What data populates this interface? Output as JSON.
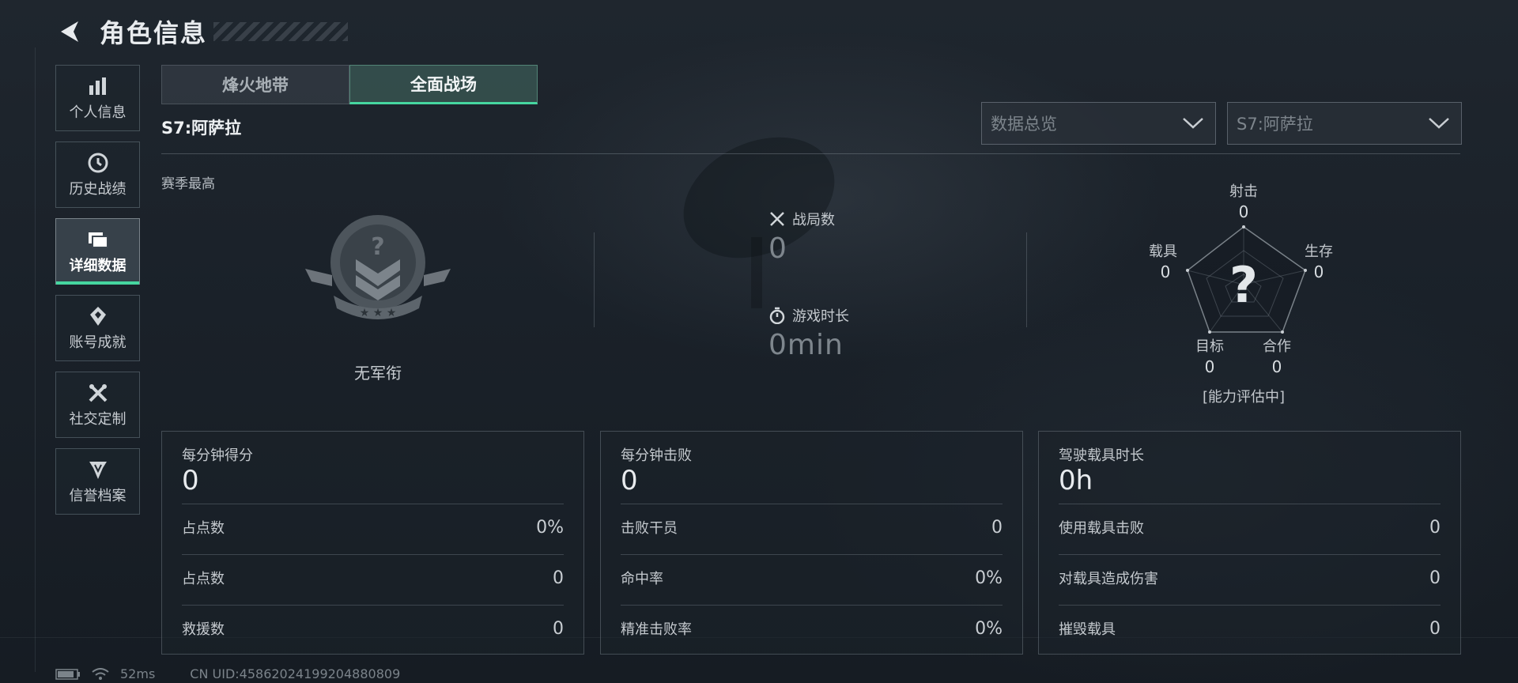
{
  "header": {
    "title": "角色信息"
  },
  "sidebar": {
    "items": [
      {
        "label": "个人信息",
        "icon": "bar-chart-icon"
      },
      {
        "label": "历史战绩",
        "icon": "history-icon"
      },
      {
        "label": "详细数据",
        "icon": "folder-icon",
        "active": true
      },
      {
        "label": "账号成就",
        "icon": "achievement-icon"
      },
      {
        "label": "社交定制",
        "icon": "tools-icon"
      },
      {
        "label": "信誉档案",
        "icon": "credit-badge-icon"
      }
    ]
  },
  "tabs": [
    {
      "label": "烽火地带",
      "active": false
    },
    {
      "label": "全面战场",
      "active": true
    }
  ],
  "season_title": "S7:阿萨拉",
  "dropdowns": {
    "data_type": "数据总览",
    "season": "S7:阿萨拉"
  },
  "season_best": {
    "label": "赛季最高",
    "rank": "无军衔"
  },
  "stats": {
    "matches_label": "战局数",
    "matches_value": "0",
    "playtime_label": "游戏时长",
    "playtime_value": "0min"
  },
  "radar": {
    "center": "?",
    "status": "[能力评估中]",
    "axes": [
      {
        "label": "射击",
        "value": "0"
      },
      {
        "label": "生存",
        "value": "0"
      },
      {
        "label": "合作",
        "value": "0"
      },
      {
        "label": "目标",
        "value": "0"
      },
      {
        "label": "载具",
        "value": "0"
      }
    ]
  },
  "cards": [
    {
      "title": "每分钟得分",
      "value": "0",
      "rows": [
        {
          "label": "占点数",
          "value": "0%"
        },
        {
          "label": "占点数",
          "value": "0"
        },
        {
          "label": "救援数",
          "value": "0"
        }
      ]
    },
    {
      "title": "每分钟击败",
      "value": "0",
      "rows": [
        {
          "label": "击败干员",
          "value": "0"
        },
        {
          "label": "命中率",
          "value": "0%"
        },
        {
          "label": "精准击败率",
          "value": "0%"
        }
      ]
    },
    {
      "title": "驾驶载具时长",
      "value": "0h",
      "rows": [
        {
          "label": "使用载具击败",
          "value": "0"
        },
        {
          "label": "对载具造成伤害",
          "value": "0"
        },
        {
          "label": "摧毁载具",
          "value": "0"
        }
      ]
    }
  ],
  "footer": {
    "ping": "52ms",
    "uid": "CN UID:45862024199204880809"
  },
  "colors": {
    "accent": "#46d6a0"
  }
}
